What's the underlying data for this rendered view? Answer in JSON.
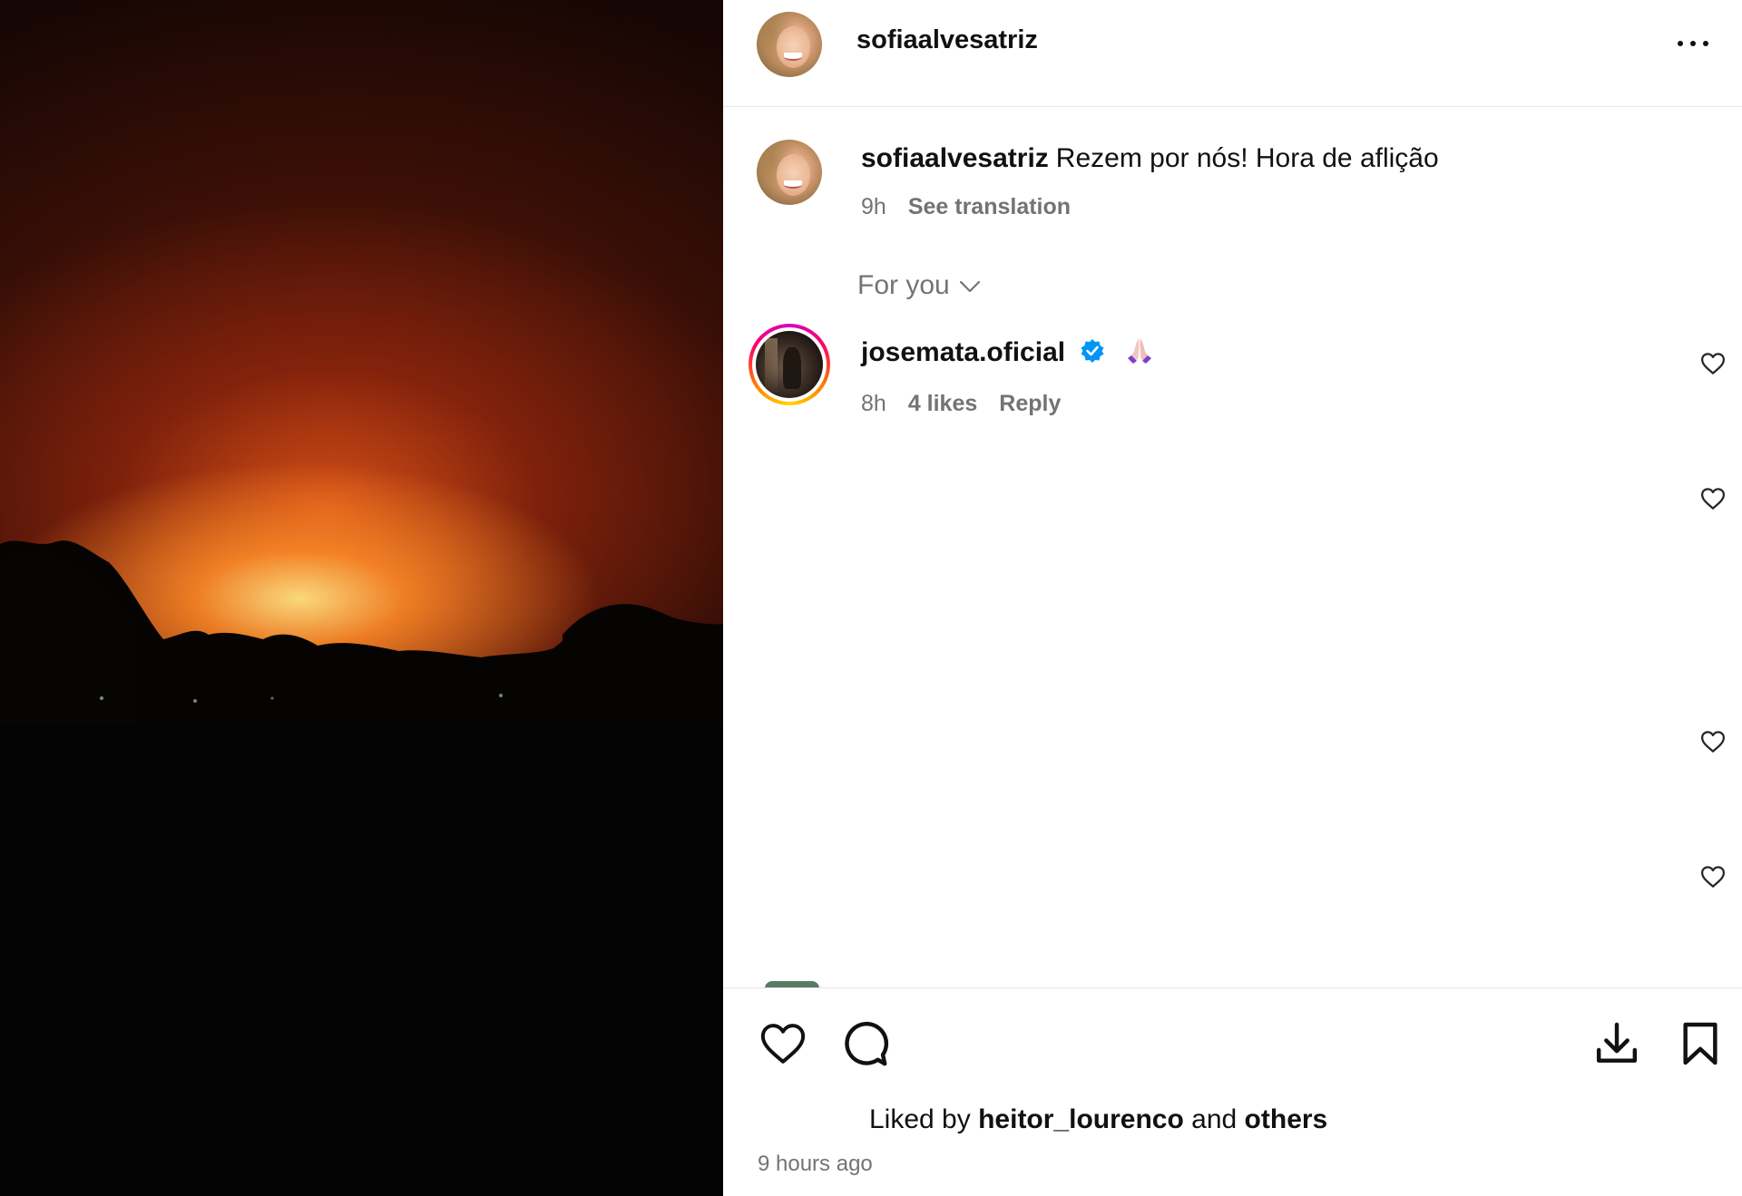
{
  "post": {
    "author": "sofiaalvesatriz",
    "image_alt": "Night wildfire glowing orange behind dark treeline"
  },
  "header": {
    "username": "sofiaalvesatriz",
    "more_icon": "more-horizontal-icon"
  },
  "caption": {
    "username": "sofiaalvesatriz",
    "text": "Rezem por nós! Hora de aflição",
    "time": "9h",
    "see_translation": "See translation"
  },
  "comments_filter": {
    "label": "For you",
    "icon": "chevron-down-icon"
  },
  "comments": [
    {
      "username": "josemata.oficial",
      "verified": true,
      "text_emoji": "pray-emoji",
      "time": "8h",
      "likes": "4 likes",
      "reply": "Reply"
    }
  ],
  "actions": {
    "like_icon": "heart-icon",
    "comment_icon": "comment-icon",
    "download_icon": "download-icon",
    "save_icon": "bookmark-icon"
  },
  "likes": {
    "prefix": "Liked by",
    "user": "heitor_lourenco",
    "connector": "and",
    "others": "others"
  },
  "timestamp": "9 hours ago",
  "colors": {
    "secondary_text": "#737373",
    "verified_blue": "#0095f6",
    "divider": "#e6e6e6"
  }
}
